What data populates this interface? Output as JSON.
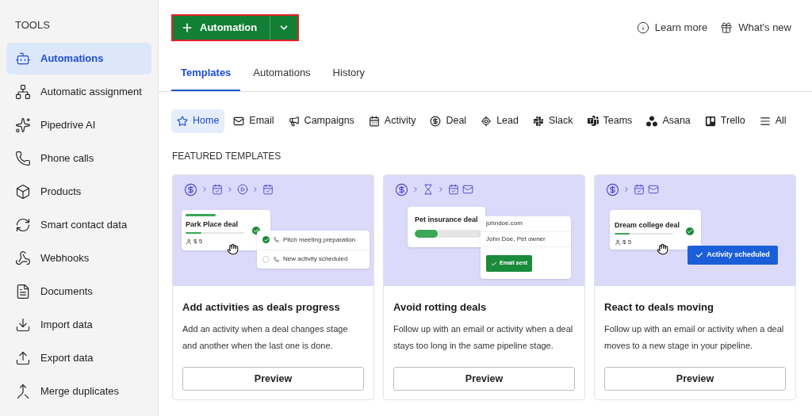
{
  "sidebar": {
    "heading": "TOOLS",
    "items": [
      {
        "label": "Automations",
        "selected": true
      },
      {
        "label": "Automatic assignment",
        "selected": false
      },
      {
        "label": "Pipedrive AI",
        "selected": false
      },
      {
        "label": "Phone calls",
        "selected": false
      },
      {
        "label": "Products",
        "selected": false
      },
      {
        "label": "Smart contact data",
        "selected": false
      },
      {
        "label": "Webhooks",
        "selected": false
      },
      {
        "label": "Documents",
        "selected": false
      },
      {
        "label": "Import data",
        "selected": false
      },
      {
        "label": "Export data",
        "selected": false
      },
      {
        "label": "Merge duplicates",
        "selected": false
      }
    ]
  },
  "header": {
    "new_button": {
      "label": "Automation"
    },
    "links": [
      {
        "label": "Learn more"
      },
      {
        "label": "What's new"
      }
    ]
  },
  "tabs": [
    {
      "label": "Templates",
      "selected": true
    },
    {
      "label": "Automations",
      "selected": false
    },
    {
      "label": "History",
      "selected": false
    }
  ],
  "categories": [
    {
      "label": "Home",
      "selected": true
    },
    {
      "label": "Email",
      "selected": false
    },
    {
      "label": "Campaigns",
      "selected": false
    },
    {
      "label": "Activity",
      "selected": false
    },
    {
      "label": "Deal",
      "selected": false
    },
    {
      "label": "Lead",
      "selected": false
    },
    {
      "label": "Slack",
      "selected": false
    },
    {
      "label": "Teams",
      "selected": false
    },
    {
      "label": "Asana",
      "selected": false
    },
    {
      "label": "Trello",
      "selected": false
    },
    {
      "label": "All",
      "selected": false
    }
  ],
  "section_title": "FEATURED TEMPLATES",
  "templates": [
    {
      "title": "Add activities as deals progress",
      "description": "Add an activity when a deal changes stage and another when the last one is done.",
      "button": "Preview",
      "illustration": {
        "kind": "checklist",
        "deal": "Park Place deal",
        "value": "$ 5",
        "level": 0.27,
        "tasks": [
          {
            "label": "Pitch meeting preparation",
            "checked": true
          },
          {
            "label": "New activity scheduled",
            "checked": false
          }
        ]
      }
    },
    {
      "title": "Avoid rotting deals",
      "description": "Follow up with an email or activity when a deal stays too long in the same pipeline stage.",
      "button": "Preview",
      "illustration": {
        "kind": "email",
        "deal": "Pet insurance deal",
        "level": 0.35,
        "email": "johndoe.com",
        "contact": "John Doe, Pet owner",
        "badge": "Email sent"
      }
    },
    {
      "title": "React to deals moving",
      "description": "Follow up with an email or activity when a deal moves to a new stage in your pipeline.",
      "button": "Preview",
      "illustration": {
        "kind": "scheduled",
        "deal": "Dream college deal",
        "value": "$ 5",
        "level": 0.25,
        "badge": "Activity scheduled"
      }
    }
  ]
}
